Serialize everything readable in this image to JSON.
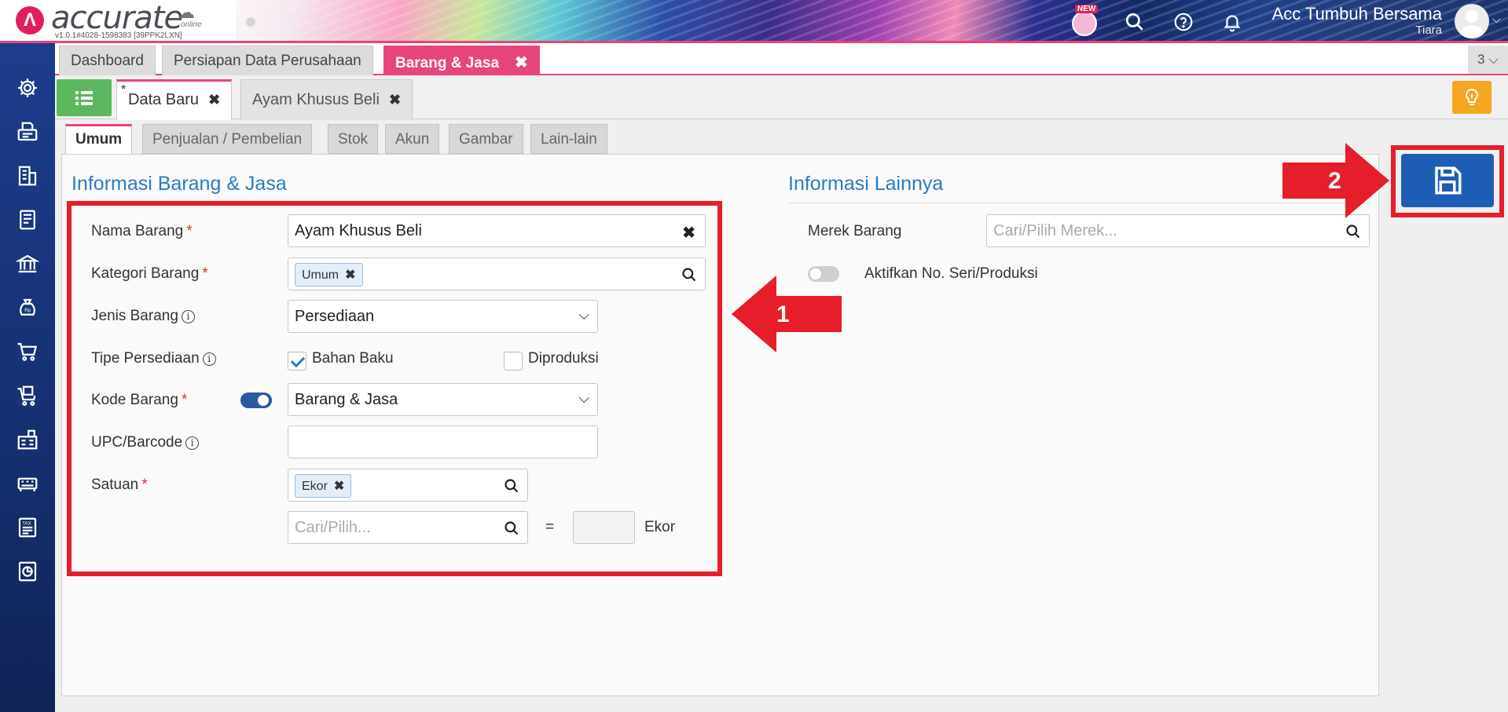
{
  "app": {
    "logo_text": "accurate",
    "logo_sub": "online",
    "version": "v1.0.1#4028-1598383 [39PPK2LXN]",
    "new_badge": "NEW",
    "company_name": "Acc Tumbuh Bersama",
    "user_name": "Tiara"
  },
  "module_tabs": [
    {
      "label": "Dashboard",
      "active": false
    },
    {
      "label": "Persiapan Data Perusahaan",
      "active": false
    },
    {
      "label": "Barang & Jasa",
      "active": true,
      "close": "✖"
    }
  ],
  "tab_counter": "3 ⌵",
  "doc_tabs": [
    {
      "label": "Data Baru",
      "modified_mark": "*",
      "close": "✖",
      "active": true
    },
    {
      "label": "Ayam Khusus Beli",
      "close": "✖",
      "active": false
    }
  ],
  "section_tabs": [
    "Umum",
    "Penjualan / Pembelian",
    "Stok",
    "Akun",
    "Gambar",
    "Lain-lain"
  ],
  "info_barang": {
    "title": "Informasi Barang & Jasa",
    "nama_barang": {
      "label": "Nama Barang",
      "required": "*",
      "value": "Ayam Khusus Beli"
    },
    "kategori_barang": {
      "label": "Kategori Barang",
      "required": "*",
      "chip": "Umum"
    },
    "jenis_barang": {
      "label": "Jenis Barang",
      "value": "Persediaan"
    },
    "tipe_persediaan": {
      "label": "Tipe Persediaan",
      "option1": "Bahan Baku",
      "option1_checked": true,
      "option2": "Diproduksi",
      "option2_checked": false
    },
    "kode_barang": {
      "label": "Kode Barang",
      "required": "*",
      "auto_toggle_on": true,
      "value": "Barang & Jasa"
    },
    "upc_barcode": {
      "label": "UPC/Barcode",
      "value": ""
    },
    "satuan": {
      "label": "Satuan",
      "required": "*",
      "chip": "Ekor",
      "conv_placeholder": "Cari/Pilih...",
      "equals": "=",
      "conv_qty": "",
      "conv_unit": "Ekor"
    }
  },
  "info_lainnya": {
    "title": "Informasi Lainnya",
    "merek_barang": {
      "label": "Merek Barang",
      "placeholder": "Cari/Pilih Merek..."
    },
    "serial": {
      "label": "Aktifkan No. Seri/Produksi",
      "toggle_on": false
    }
  },
  "annotations": {
    "arrow1": "1",
    "arrow2": "2"
  },
  "colors": {
    "accent_pink": "#e8457a",
    "primary_blue": "#1d5db5",
    "title_blue": "#2b7bc1",
    "annotation_red": "#e61e2b",
    "success_green": "#5cb85c",
    "warning_orange": "#f5a623",
    "sidebar_navy": "#152f70"
  }
}
